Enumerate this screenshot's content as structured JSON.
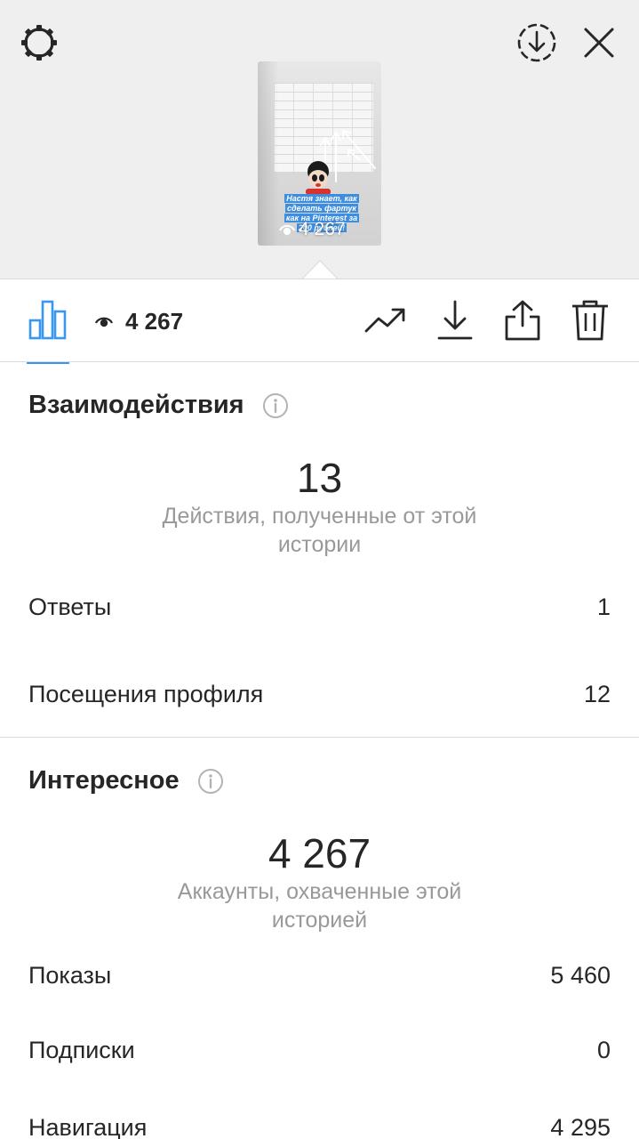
{
  "story": {
    "caption": "Настя знает, как сделать фартук как на Pinterest за 200 рублей!",
    "views": "4 267"
  },
  "toolbar": {
    "views_count": "4 267"
  },
  "interactions": {
    "title": "Взаимодействия",
    "value": "13",
    "caption": "Действия, полученные от этой истории",
    "rows": [
      {
        "label": "Ответы",
        "value": "1"
      },
      {
        "label": "Посещения профиля",
        "value": "12"
      }
    ]
  },
  "discovery": {
    "title": "Интересное",
    "value": "4 267",
    "caption": "Аккаунты, охваченные этой историей",
    "rows": [
      {
        "label": "Показы",
        "value": "5 460"
      },
      {
        "label": "Подписки",
        "value": "0"
      },
      {
        "label": "Навигация",
        "value": "4 295"
      }
    ]
  },
  "colors": {
    "accent": "#3897f0",
    "text": "#262626",
    "muted": "#999999",
    "top_background": "#efefef"
  },
  "icons": [
    "settings-icon",
    "download-circle-icon",
    "close-icon",
    "bar-chart-icon",
    "eye-icon",
    "trending-icon",
    "download-icon",
    "share-icon",
    "trash-icon",
    "info-icon"
  ]
}
